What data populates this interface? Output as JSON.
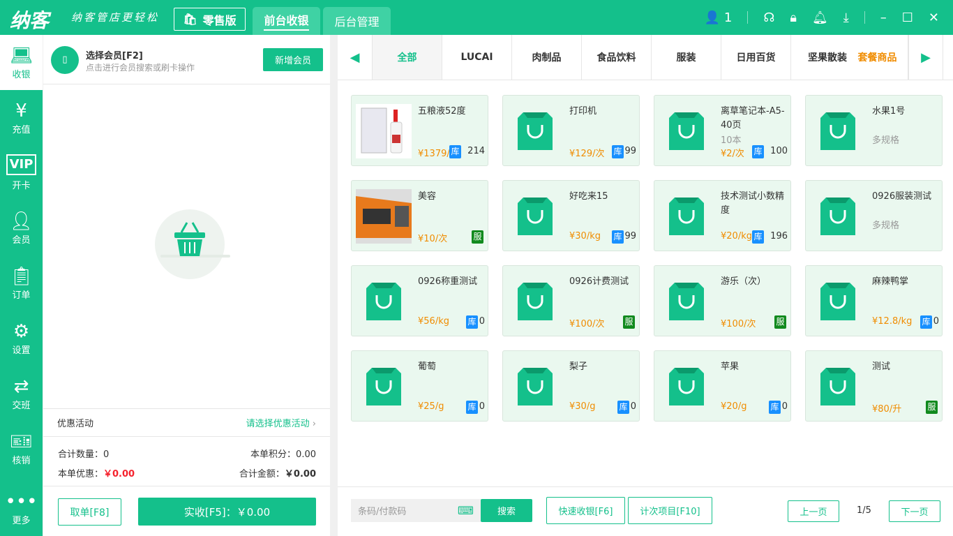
{
  "header": {
    "logo": "纳客",
    "slogan": "纳客管店更轻松",
    "edition": "零售版",
    "tabs": [
      "前台收银",
      "后台管理"
    ],
    "user_count": "1"
  },
  "sidebar": [
    {
      "label": "收银",
      "icon": "cashier-icon"
    },
    {
      "label": "充值",
      "icon": "recharge-icon"
    },
    {
      "label": "开卡",
      "icon": "vip-card-icon"
    },
    {
      "label": "会员",
      "icon": "member-icon"
    },
    {
      "label": "订单",
      "icon": "order-icon"
    },
    {
      "label": "设置",
      "icon": "settings-icon"
    },
    {
      "label": "交班",
      "icon": "shift-icon"
    },
    {
      "label": "核销",
      "icon": "ticket-icon"
    },
    {
      "label": "更多",
      "icon": "more-icon"
    }
  ],
  "member": {
    "title": "选择会员[F2]",
    "subtitle": "点击进行会员搜索或刷卡操作",
    "add_button": "新增会员"
  },
  "promo": {
    "label": "优惠活动",
    "action": "请选择优惠活动"
  },
  "totals": {
    "qty_label": "合计数量：",
    "qty": "0",
    "points_label": "本单积分：",
    "points": "0.00",
    "discount_label": "本单优惠：",
    "discount": "￥0.00",
    "amount_label": "合计金额：",
    "amount": "￥0.00"
  },
  "actions": {
    "cancel": "取单[F8]",
    "pay": "实收[F5]：￥0.00"
  },
  "categories": [
    "全部",
    "LUCAI",
    "肉制品",
    "食品饮料",
    "服装",
    "日用百货",
    "坚果散装",
    "套餐商品"
  ],
  "products": [
    {
      "name": "五粮液52度",
      "price": "¥1379/瓶",
      "badge": "库",
      "stock": "214",
      "img": "bottle"
    },
    {
      "name": "打印机",
      "price": "¥129/次",
      "badge": "库",
      "stock": "99"
    },
    {
      "name": "离草笔记本-A5-40页",
      "sub": "10本",
      "price": "¥2/次",
      "badge": "库",
      "stock": "100"
    },
    {
      "name": "水果1号",
      "sub": "多规格"
    },
    {
      "name": "美容",
      "price": "¥10/次",
      "badge": "服",
      "img": "machine"
    },
    {
      "name": "好吃来15",
      "price": "¥30/kg",
      "badge": "库",
      "stock": "99"
    },
    {
      "name": "技术测试小数精度",
      "price": "¥20/kg",
      "badge": "库",
      "stock": "196"
    },
    {
      "name": "0926服装测试",
      "sub": "多规格"
    },
    {
      "name": "0926称重测试",
      "price": "¥56/kg",
      "badge": "库",
      "stock": "0"
    },
    {
      "name": "0926计费测试",
      "price": "¥100/次",
      "badge": "服"
    },
    {
      "name": "游乐（次）",
      "price": "¥100/次",
      "badge": "服"
    },
    {
      "name": "麻辣鸭掌",
      "price": "¥12.8/kg",
      "badge": "库",
      "stock": "0"
    },
    {
      "name": "葡萄",
      "price": "¥25/g",
      "badge": "库",
      "stock": "0"
    },
    {
      "name": "梨子",
      "price": "¥30/g",
      "badge": "库",
      "stock": "0"
    },
    {
      "name": "苹果",
      "price": "¥20/g",
      "badge": "库",
      "stock": "0"
    },
    {
      "name": "测试",
      "price": "¥80/升",
      "badge": "服"
    }
  ],
  "bottom": {
    "search_placeholder": "条码/付款码",
    "search": "搜索",
    "quick": "快速收银[F6]",
    "count": "计次项目[F10]",
    "prev": "上一页",
    "page": "1/5",
    "next": "下一页"
  }
}
